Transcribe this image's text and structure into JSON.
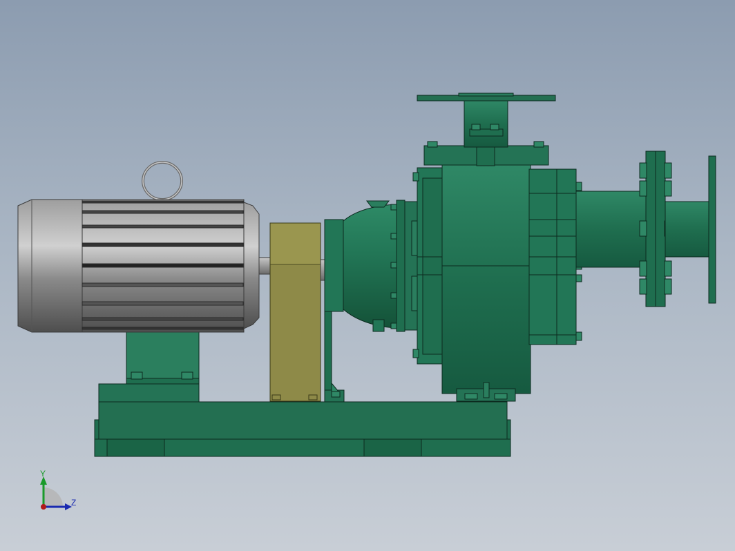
{
  "viewport": {
    "background_top": "#8c9cb0",
    "background_bottom": "#c8ced6"
  },
  "colors": {
    "pump_green": "#1f6e4f",
    "pump_green_light": "#2f8866",
    "pump_green_dark": "#165a40",
    "motor_gray": "#9a9a9a",
    "motor_gray_dark": "#5e5e5e",
    "coupling_guard_olive": "#8e8a48",
    "outline": "#0c2a1f"
  },
  "triad": {
    "y_label": "Y",
    "z_label": "Z",
    "y_color": "#1a9a2a",
    "z_color": "#1a2ab0",
    "origin_color": "#b01a1a"
  }
}
